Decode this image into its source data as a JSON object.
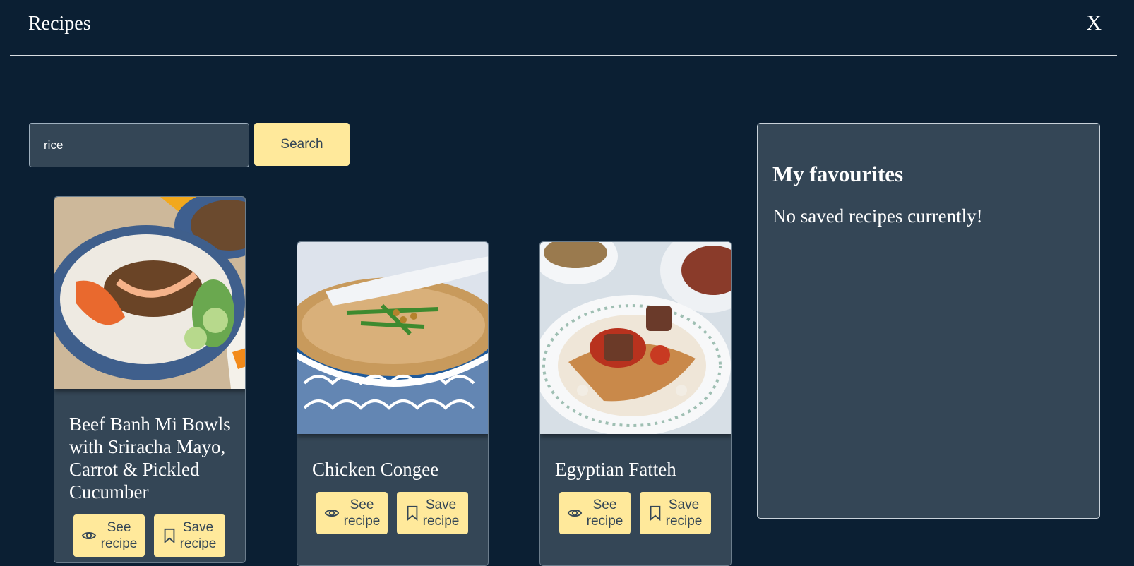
{
  "header": {
    "title": "Recipes",
    "close_label": "X"
  },
  "search": {
    "value": "rice",
    "button_label": "Search"
  },
  "recipes": [
    {
      "title": "Beef Banh Mi Bowls with Sriracha Mayo, Carrot & Pickled Cucumber",
      "see_label": "See\nrecipe",
      "save_label": "Save\nrecipe"
    },
    {
      "title": "Chicken Congee",
      "see_label": "See\nrecipe",
      "save_label": "Save\nrecipe"
    },
    {
      "title": "Egyptian Fatteh",
      "see_label": "See\nrecipe",
      "save_label": "Save\nrecipe"
    }
  ],
  "favourites": {
    "heading": "My favourites",
    "empty_message": "No saved recipes currently!"
  },
  "icons": {
    "see": "eye-icon",
    "save": "bookmark-icon"
  },
  "colors": {
    "background": "#0b1f33",
    "panel": "#344656",
    "accent": "#ffe99b"
  }
}
